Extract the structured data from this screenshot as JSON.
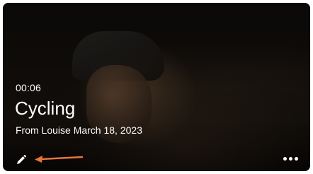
{
  "video_card": {
    "duration": "00:06",
    "title": "Cycling",
    "subtitle": "From Louise March 18, 2023",
    "thumbnail_subject": "cyclist wearing helmet at night",
    "edit_icon": "pencil-icon",
    "more_icon": "more-horizontal-icon",
    "annotation_color": "#e8743a"
  }
}
